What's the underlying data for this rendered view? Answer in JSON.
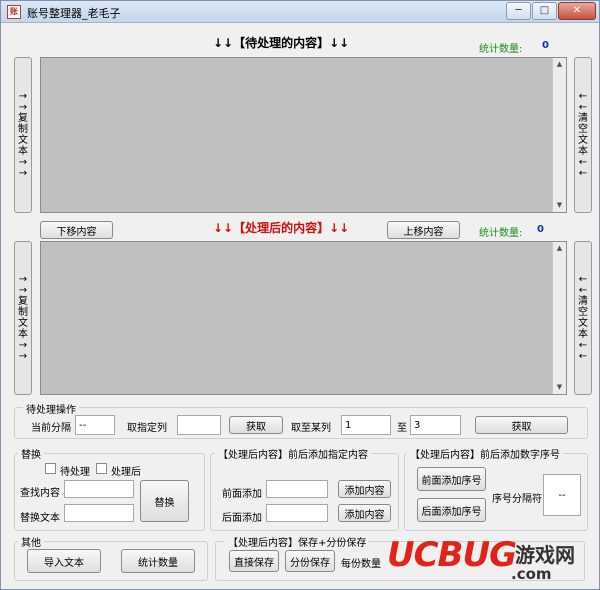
{
  "window": {
    "title": "账号整理器_老毛子",
    "minimize": "─",
    "maximize": "□",
    "close": "✕"
  },
  "top": {
    "heading": "↓↓【待处理的内容】↓↓",
    "count_label": "统计数量:",
    "count_value": "0",
    "copy_btn": [
      "→",
      "→",
      "复",
      "制",
      "文",
      "本",
      "→",
      "→"
    ],
    "clear_btn": [
      "←",
      "←",
      "清",
      "空",
      "文",
      "本",
      "←",
      "←"
    ]
  },
  "middle": {
    "move_down": "下移内容",
    "heading": "↓↓【处理后的内容】↓↓",
    "move_up": "上移内容",
    "count_label": "统计数量:",
    "count_value": "0"
  },
  "bottom_copy_btn": [
    "→",
    "→",
    "复",
    "制",
    "文",
    "本",
    "→",
    "→"
  ],
  "bottom_clear_btn": [
    "←",
    "←",
    "清",
    "空",
    "文",
    "本",
    "←",
    "←"
  ],
  "pending_ops": {
    "title": "待处理操作",
    "current_sep_label": "当前分隔",
    "current_sep_value": "--",
    "take_col_label": "取指定列",
    "take_col_value": "",
    "get_btn_1": "获取",
    "take_range_label": "取至某列",
    "range_from": "1",
    "range_to_label": "至",
    "range_to": "3",
    "get_btn_2": "获取"
  },
  "replace": {
    "title": "替换",
    "pending_label": "待处理",
    "processed_label": "处理后",
    "find_label": "查找内容",
    "replace_label": "替换文本",
    "replace_btn": "替换"
  },
  "add_content": {
    "title": "【处理后内容】前后添加指定内容",
    "front_label": "前面添加",
    "back_label": "后面添加",
    "add_btn_1": "添加内容",
    "add_btn_2": "添加内容"
  },
  "add_number": {
    "title": "【处理后内容】前后添加数字序号",
    "front_btn": "前面添加序号",
    "back_btn": "后面添加序号",
    "sep_label": "序号分隔符",
    "sep_value": "--"
  },
  "other": {
    "title": "其他",
    "import_btn": "导入文本",
    "stats_btn": "统计数量"
  },
  "save": {
    "title": "【处理后内容】保存+分份保存",
    "direct_btn": "直接保存",
    "split_btn": "分份保存",
    "per_label": "每份数量"
  },
  "watermark": {
    "brand": "UCBUG",
    "cn": "游戏网",
    "com": ".com"
  }
}
